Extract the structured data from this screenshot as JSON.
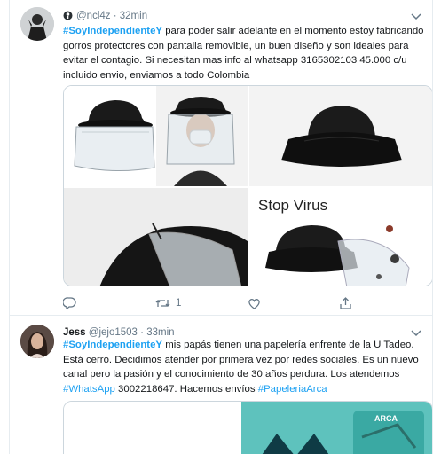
{
  "tweets": [
    {
      "handle": "@ncl4z",
      "time": "32min",
      "hashtag": "#SoyIndependienteY",
      "text": " para poder salir adelante en el momento estoy fabricando gorros protectores con pantalla removible, un buen diseño y son ideales para evitar el contagio. Si necesitan mas info al whatsapp 3165302103 45.000 c/u incluido envio, enviamos a todo Colombia",
      "media_caption": "Stop Virus",
      "actions": {
        "reply": "",
        "retweet": "1",
        "like": ""
      }
    },
    {
      "name": "Jess",
      "handle": "@jejo1503",
      "time": "33min",
      "hashtag": "#SoyIndependienteY",
      "text_a": "  mis papás tienen una papelería enfrente de la U Tadeo. Está cerró. Decidimos atender por primera vez por redes sociales. Es un nuevo canal pero la pasión y el conocimiento de 30 años perdura. Los atendemos ",
      "hashtag2": "#WhatsApp",
      "text_b": " 3002218647. Hacemos envíos ",
      "hashtag3": "#PapeleriaArca",
      "media_caption": "ARCA"
    }
  ]
}
